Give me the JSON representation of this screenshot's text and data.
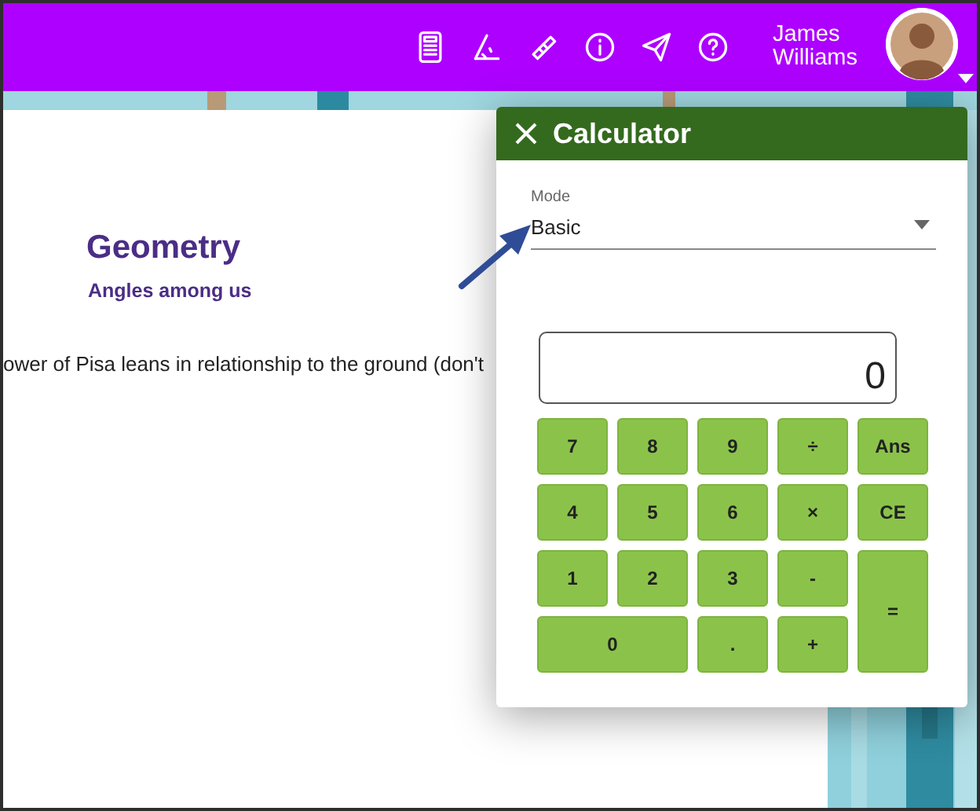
{
  "user": {
    "name": "James Williams"
  },
  "lesson": {
    "title": "Geometry",
    "subtitle": "Angles among us",
    "text": "ower of Pisa leans in relationship to the ground (don't"
  },
  "calculator": {
    "title": "Calculator",
    "mode": {
      "label": "Mode",
      "value": "Basic"
    },
    "display": "0",
    "keys": [
      {
        "label": "7",
        "kind": "key"
      },
      {
        "label": "8",
        "kind": "key"
      },
      {
        "label": "9",
        "kind": "key"
      },
      {
        "label": "÷",
        "kind": "key"
      },
      {
        "label": "Ans",
        "kind": "key"
      },
      {
        "label": "4",
        "kind": "key"
      },
      {
        "label": "5",
        "kind": "key"
      },
      {
        "label": "6",
        "kind": "key"
      },
      {
        "label": "×",
        "kind": "key"
      },
      {
        "label": "CE",
        "kind": "key"
      },
      {
        "label": "1",
        "kind": "key"
      },
      {
        "label": "2",
        "kind": "key"
      },
      {
        "label": "3",
        "kind": "key"
      },
      {
        "label": "-",
        "kind": "key"
      },
      {
        "label": "=",
        "kind": "tall"
      },
      {
        "label": "0",
        "kind": "wide"
      },
      {
        "label": ".",
        "kind": "key"
      },
      {
        "label": "+",
        "kind": "key"
      }
    ]
  }
}
